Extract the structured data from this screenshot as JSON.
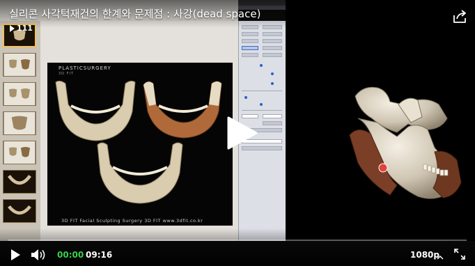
{
  "video": {
    "title": "실리콘 사각턱재건의 한계와 문제점 : 사강(dead space)"
  },
  "slide_app": {
    "thumb_counter": "111",
    "slide_logo": "PLASTICSURGERY",
    "slide_logo_sub": "3D FIT",
    "slide_caption": "3D FIT Facial Sculpting Surgery  3D FIT  www.3dfit.co.kr"
  },
  "controls": {
    "current_time": "00:00",
    "duration": "09:16",
    "quality": "1080p",
    "progress_fraction": 0.0
  },
  "colors": {
    "accent_green": "#36d24a",
    "title_text": "#ffffff"
  },
  "icons": {
    "share": "share-icon",
    "play": "play-icon",
    "volume": "volume-icon",
    "quality_menu": "chevron-up-icon",
    "fullscreen": "fullscreen-icon",
    "big_play": "play-overlay-icon"
  }
}
